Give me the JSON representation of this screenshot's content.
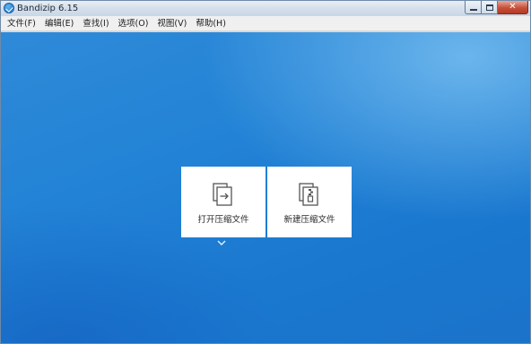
{
  "window": {
    "title": "Bandizip 6.15"
  },
  "menubar": {
    "items": [
      {
        "label": "文件(F)"
      },
      {
        "label": "编辑(E)"
      },
      {
        "label": "查找(I)"
      },
      {
        "label": "选项(O)"
      },
      {
        "label": "视图(V)"
      },
      {
        "label": "帮助(H)"
      }
    ]
  },
  "main": {
    "cards": [
      {
        "label": "打开压缩文件",
        "icon": "open-archive-icon"
      },
      {
        "label": "新建压缩文件",
        "icon": "new-archive-icon"
      }
    ],
    "more_icon": "chevron-down-icon"
  },
  "colors": {
    "background_blue": "#2383d6",
    "card": "#ffffff"
  }
}
